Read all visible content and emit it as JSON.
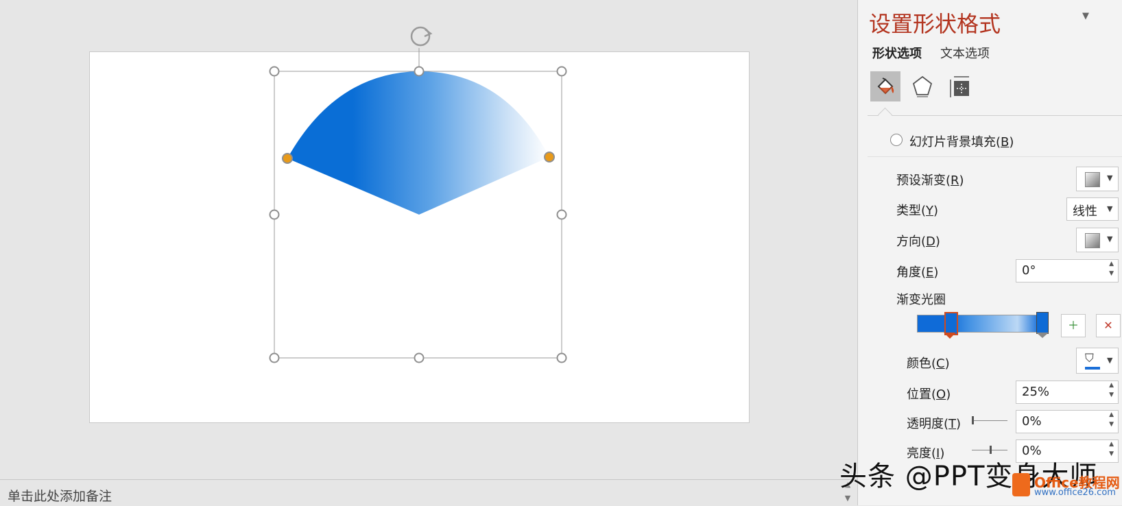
{
  "canvas": {
    "notes_placeholder": "单击此处添加备注",
    "scroll_up": "▲",
    "scroll_down": "▼"
  },
  "shape": {
    "type": "sector",
    "fill_colors": [
      "#0a6ed6",
      "#4a96e2",
      "#cfe3f7",
      "#ffffff"
    ],
    "handle_color": "#e89a1a"
  },
  "pane": {
    "title": "设置形状格式",
    "caret": "▼",
    "tabs": [
      {
        "label": "形状选项",
        "active": true
      },
      {
        "label": "文本选项",
        "active": false
      }
    ],
    "categories": [
      "fill-line-icon",
      "effects-pentagon-icon",
      "size-properties-icon"
    ],
    "slide_bg_fill": {
      "label_pre": "幻灯片背景填充(",
      "key": "B",
      "label_post": ")"
    },
    "preset_gradient": {
      "label_pre": "预设渐变(",
      "key": "R",
      "label_post": ")"
    },
    "type": {
      "label_pre": "类型(",
      "key": "Y",
      "label_post": ")",
      "value": "线性"
    },
    "direction": {
      "label_pre": "方向(",
      "key": "D",
      "label_post": ")"
    },
    "angle": {
      "label_pre": "角度(",
      "key": "E",
      "label_post": ")",
      "value": "0°"
    },
    "gradient_stops": {
      "label": "渐变光圈",
      "selected_stop": 1
    },
    "color": {
      "label_pre": "颜色(",
      "key": "C",
      "label_post": ")",
      "swatch": "#1a6fd8"
    },
    "position": {
      "label_pre": "位置(",
      "key": "O",
      "label_post": ")",
      "value": "25%"
    },
    "transparency": {
      "label_pre": "透明度(",
      "key": "T",
      "label_post": ")",
      "value": "0%",
      "level": 0
    },
    "brightness": {
      "label_pre": "亮度(",
      "key": "I",
      "label_post": ")",
      "value": "0%",
      "level": 0.5
    }
  },
  "watermark": {
    "text": "头条 @PPT变身大师",
    "brand": "Office教程网",
    "url": "www.office26.com"
  },
  "colors": {
    "accent_title": "#b3341f",
    "selected_stop_border": "#d04a1d",
    "stop_fill": "#0e6bd6"
  }
}
